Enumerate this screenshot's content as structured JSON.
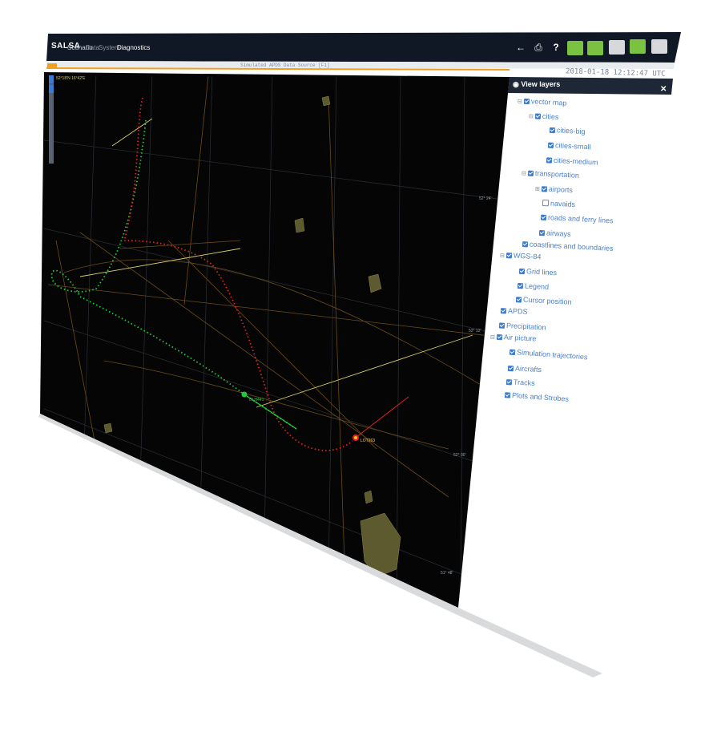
{
  "app": {
    "logo": "SALSA",
    "menu": [
      "Scenario",
      "Data",
      "System",
      "Diagnostics"
    ],
    "active_menu": "Diagnostics",
    "subtitle": "Simulated APDS Data Source [F1]",
    "clock": "2018-01-18 12:12:47 UTC",
    "cursor_readout": "52°18'N 16°42'E"
  },
  "toolbar": {
    "icons": [
      "back-arrow-icon",
      "print-icon",
      "help-icon",
      "share-icon",
      "layers-icon",
      "cloud-icon",
      "upload-icon",
      "settings-icon"
    ],
    "help_label": "?",
    "accent": "#7cc242"
  },
  "layers_panel": {
    "title": "View layers",
    "close_label": "✕",
    "items": [
      {
        "label": "vector map",
        "checked": true,
        "toggle": "⊟"
      },
      {
        "label": "cities",
        "checked": true,
        "toggle": "⊟"
      },
      {
        "label": "cities-big",
        "checked": true
      },
      {
        "label": "cities-small",
        "checked": true
      },
      {
        "label": "cities-medium",
        "checked": true
      },
      {
        "label": "transportation",
        "checked": true,
        "toggle": "⊟"
      },
      {
        "label": "airports",
        "checked": true,
        "toggle": "⊞"
      },
      {
        "label": "navaids",
        "checked": false
      },
      {
        "label": "roads and ferry lines",
        "checked": true
      },
      {
        "label": "airways",
        "checked": true
      },
      {
        "label": "coastlines and boundaries",
        "checked": true
      },
      {
        "label": "WGS-84",
        "checked": true,
        "toggle": "⊟"
      },
      {
        "label": "Grid lines",
        "checked": true
      },
      {
        "label": "Legend",
        "checked": true
      },
      {
        "label": "Cursor position",
        "checked": true
      },
      {
        "label": "APDS",
        "checked": true
      },
      {
        "label": "Precipitation",
        "checked": true
      },
      {
        "label": "Air picture",
        "checked": true,
        "toggle": "⊟"
      },
      {
        "label": "Simulation trajectories",
        "checked": true
      },
      {
        "label": "Aircrafts",
        "checked": true
      },
      {
        "label": "Tracks",
        "checked": true
      },
      {
        "label": "Plots and Strobes",
        "checked": true
      }
    ]
  },
  "map": {
    "lat_labels": [
      "52° 24'",
      "52° 12'",
      "52° 00'",
      "51° 48'"
    ],
    "aircraft": [
      {
        "label": "DLH441",
        "color": "#22cc33"
      },
      {
        "label": "LOT263",
        "color": "#ff3322"
      }
    ],
    "colors": {
      "bg": "#050505",
      "grid": "#2a2f36",
      "route": "#7a5a20",
      "green_track": "#27c83a",
      "red_track": "#e02222",
      "yellow": "#d9d06a"
    }
  }
}
